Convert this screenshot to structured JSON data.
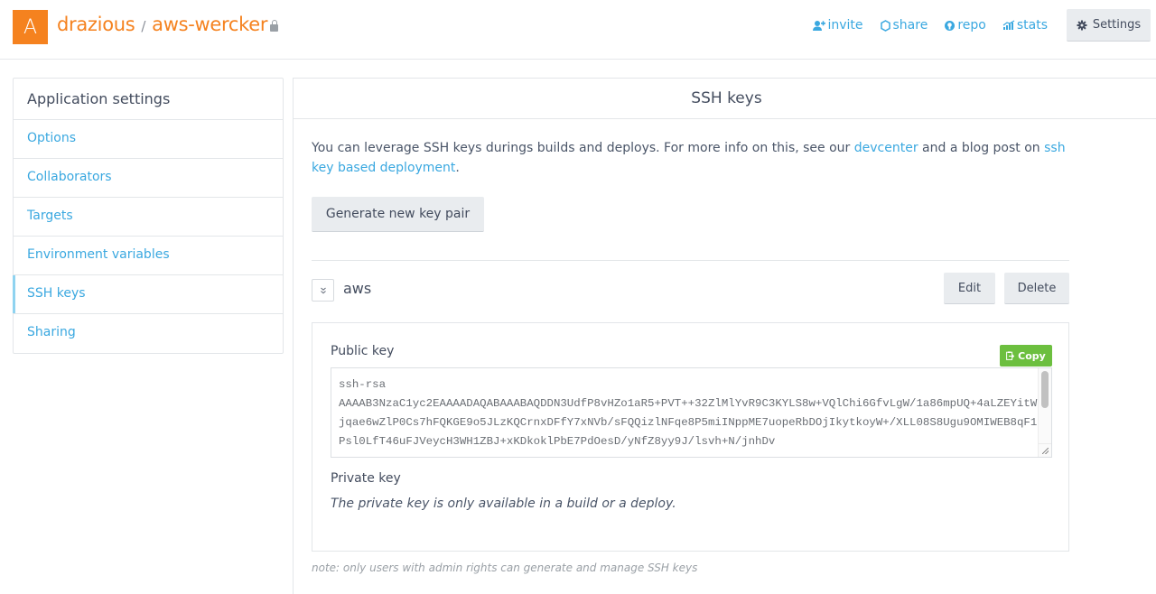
{
  "header": {
    "avatar_letter": "A",
    "owner": "drazious",
    "separator": "/",
    "app_name": "aws-wercker",
    "private_icon": "lock-icon",
    "nav": [
      {
        "label": "invite",
        "icon": "add-user-icon"
      },
      {
        "label": "share",
        "icon": "share-icon"
      },
      {
        "label": "repo",
        "icon": "github-icon"
      },
      {
        "label": "stats",
        "icon": "stats-icon"
      }
    ],
    "settings_label": "Settings",
    "settings_icon": "gear-icon"
  },
  "sidebar": {
    "title": "Application settings",
    "items": [
      {
        "label": "Options",
        "active": false
      },
      {
        "label": "Collaborators",
        "active": false
      },
      {
        "label": "Targets",
        "active": false
      },
      {
        "label": "Environment variables",
        "active": false
      },
      {
        "label": "SSH keys",
        "active": true
      },
      {
        "label": "Sharing",
        "active": false
      }
    ]
  },
  "main": {
    "title": "SSH keys",
    "intro_before": "You can leverage SSH keys durings builds and deploys. For more info on this, see our ",
    "intro_link1": "devcenter",
    "intro_middle": " and a blog post on ",
    "intro_link2": "ssh key based deployment",
    "intro_after": ".",
    "generate_label": "Generate new key pair",
    "key": {
      "name": "aws",
      "toggle_icon": "chevron-double-down-icon",
      "edit_label": "Edit",
      "delete_label": "Delete",
      "public_label": "Public key",
      "copy_label": "Copy",
      "copy_icon": "clipboard-icon",
      "public_value": "ssh-rsa\nAAAAB3NzaC1yc2EAAAADAQABAAABAQDDN3UdfP8vHZo1aR5+PVT++32ZlMlYvR9C3KYLS8w+VQlChi6GfvLgW/1a86mpUQ+4aLZEYitWjqae6wZlP0Cs7hFQKGE9o5JLzKQCrnxDFfY7xNVb/sFQQizlNFqe8P5miINppME7uopeRbDOjIkytkoyW+/XLL08S8Ugu9OMIWEB8qF1Psl0LfT46uFJVeycH3WH1ZBJ+xKDkoklPbE7PdOesD/yNfZ8yy9J/lsvh+N/jnhDv",
      "private_label": "Private key",
      "private_text": "The private key is only available in a build or a deploy."
    },
    "note": "note: only users with admin rights can generate and manage SSH keys"
  },
  "colors": {
    "brand_orange": "#f5821f",
    "link_blue": "#3aa8e0",
    "copy_green": "#6cbf3f",
    "active_indicator": "#8fd3f0"
  }
}
